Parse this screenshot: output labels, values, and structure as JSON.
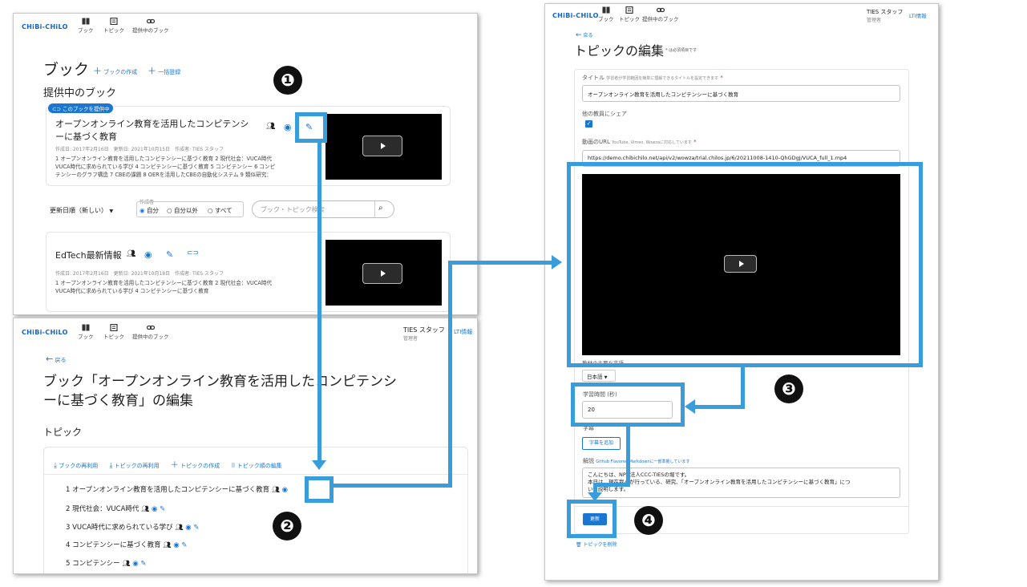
{
  "app": {
    "logo": "CHiBi-CHiLO",
    "user_name": "TIES スタッフ",
    "user_role": "管理者",
    "lti_link": "LTI情報"
  },
  "nav": {
    "book": "ブック",
    "topic": "トピック",
    "shared_book": "提供中のブック"
  },
  "book_list": {
    "title": "ブック",
    "create_link": "ブックの作成",
    "bulk_link": "一括登録",
    "section_title": "提供中のブック",
    "card1": {
      "badge": "このブックを提供中",
      "title_line1": "オープンオンライン教育を活用したコンピテンシ",
      "title_line2": "ーに基づく教育",
      "meta": "作成日: 2017年2月16日　更新日: 2021年10月15日　作成者: TIES スタッフ",
      "desc_line1": "1 オープンオンライン教育を活用したコンピテンシーに基づく教育 2 現代社会：VUCA時代",
      "desc_line2": "VUCA時代に求められている学び 4 コンピテンシーに基づく教育 5 コンピテンシー 6 コンピ",
      "desc_line3": "テンシーのグラフ構造 7 CBEの課題 8 OERを活用したCBEの自動化システム 9 類似研究："
    },
    "sort_label": "更新日順（新しい）",
    "creator_label": "作成者",
    "radio_self": "自分",
    "radio_other": "自分以外",
    "radio_all": "すべて",
    "search_placeholder": "ブック・トピック検索",
    "card2": {
      "title": "EdTech最新情報",
      "meta": "作成日: 2017年2月16日　更新日: 2021年10月18日　作成者: TIES スタッフ",
      "desc_line1": "1 オープンオンライン教育を活用したコンピテンシーに基づく教育 2 現代社会：VUCA時代",
      "desc_line2": "VUCA時代に求められている学び 4 コンピテンシーに基づく教育"
    }
  },
  "book_edit": {
    "back": "戻る",
    "title_line1": "ブック「オープンオンライン教育を活用したコンピテンシ",
    "title_line2": "ーに基づく教育」の編集",
    "section": "トピック",
    "reuse_book": "ブックの再利用",
    "reuse_topic": "トピックの再利用",
    "create_topic": "トピックの作成",
    "order_edit": "トピック順の編集",
    "topics": [
      {
        "label": "1 オープンオンライン教育を活用したコンピテンシーに基づく教育"
      },
      {
        "label": "2 現代社会：VUCA時代"
      },
      {
        "label": "3 VUCA時代に求められている学び"
      },
      {
        "label": "4 コンピテンシーに基づく教育"
      },
      {
        "label": "5 コンピテンシー"
      }
    ]
  },
  "topic_edit": {
    "back": "戻る",
    "title": "トピックの編集",
    "required_note": "* は必須項目です",
    "title_label": "タイトル",
    "title_hint": "学習者が学習範囲を簡単に理解できるタイトルを設定できます",
    "title_value": "オープンオンライン教育を活用したコンピテンシーに基づく教育",
    "share_label": "他の教員にシェア",
    "url_label": "動画のURL",
    "url_hint": "YouTube, Vimeo, Wowzaに対応しています",
    "url_value": "https://demo.chibichilo.net/api/v2/wowza/trial.chilos.jp/6/20211008-1410-QhGDgJ/VUCA_full_1.mp4",
    "lang_label": "教材の主要な言語",
    "lang_value": "日本語",
    "time_label": "学習時間 (秒)",
    "time_value": "20",
    "subtitle_label": "字幕",
    "subtitle_button": "字幕を追加",
    "desc_label": "解説",
    "desc_hint": "Github Flavored Markdownに一部準拠しています",
    "desc_line1": "こんにちは、NPO法人CCC-TIESの堀です。",
    "desc_line2": "本日は、現在我々が行っている、研究、「オープンオンライン教育を活用したコンピテンシーに基づく教育」につ",
    "desc_line3": "いて説明します。",
    "update_button": "更新",
    "delete_link": "トピックを削除"
  },
  "steps": [
    "❶",
    "❷",
    "❸",
    "❹"
  ],
  "colors": {
    "highlight": "#3a9ddb",
    "accent": "#1976d2"
  }
}
